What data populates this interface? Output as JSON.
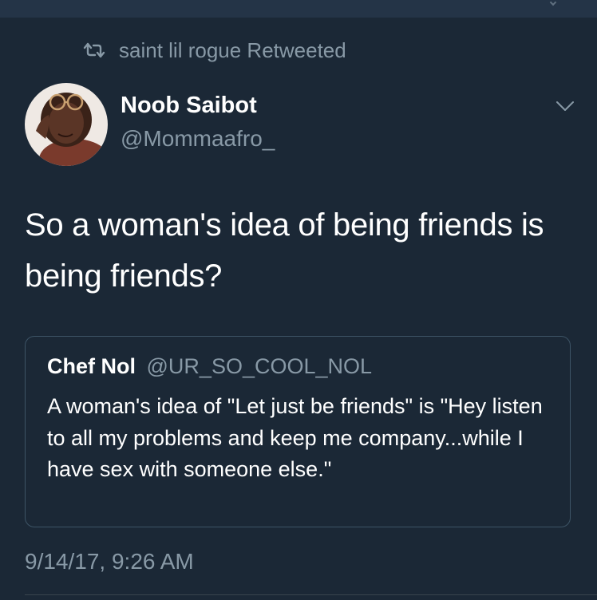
{
  "retweet": {
    "text": "saint lil rogue Retweeted",
    "icon": "retweet-icon"
  },
  "author": {
    "display_name": "Noob Saibot",
    "handle": "@Mommaafro_"
  },
  "tweet": {
    "text": "So a woman's idea of being friends is being friends?",
    "timestamp": "9/14/17, 9:26 AM"
  },
  "quote": {
    "name": "Chef Nol",
    "handle": "@UR_SO_COOL_NOL",
    "text": "A woman's idea of \"Let just be friends\" is \"Hey listen to all my problems and keep me company...while I have sex with someone else.\""
  },
  "colors": {
    "background": "#1b2836",
    "secondary_text": "#8899a6",
    "card_border": "#3d5466"
  }
}
